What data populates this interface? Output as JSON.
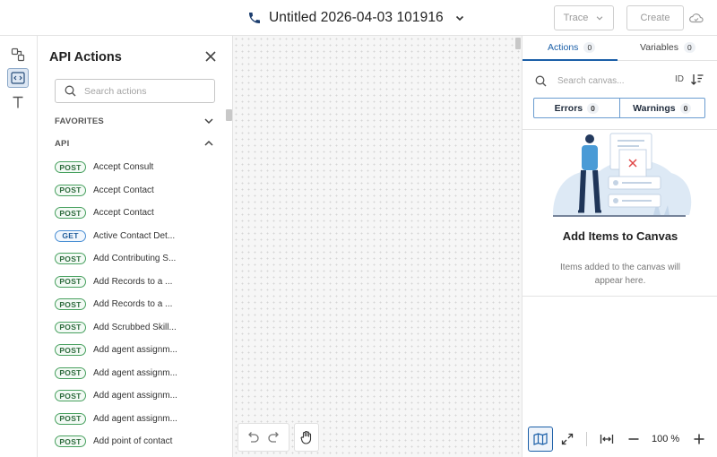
{
  "header": {
    "title": "Untitled 2026-04-03 101916",
    "trace_label": "Trace",
    "create_label": "Create"
  },
  "left_panel": {
    "title": "API Actions",
    "search_placeholder": "Search actions",
    "favorites_label": "FAVORITES",
    "api_label": "API",
    "items": [
      {
        "method": "POST",
        "label": "Accept Consult"
      },
      {
        "method": "POST",
        "label": "Accept Contact"
      },
      {
        "method": "POST",
        "label": "Accept Contact"
      },
      {
        "method": "GET",
        "label": "Active Contact Det..."
      },
      {
        "method": "POST",
        "label": "Add Contributing S..."
      },
      {
        "method": "POST",
        "label": "Add Records to a ..."
      },
      {
        "method": "POST",
        "label": "Add Records to a ..."
      },
      {
        "method": "POST",
        "label": "Add Scrubbed Skill..."
      },
      {
        "method": "POST",
        "label": "Add agent assignm..."
      },
      {
        "method": "POST",
        "label": "Add agent assignm..."
      },
      {
        "method": "POST",
        "label": "Add agent assignm..."
      },
      {
        "method": "POST",
        "label": "Add agent assignm..."
      },
      {
        "method": "POST",
        "label": "Add point of contact"
      }
    ]
  },
  "right_panel": {
    "tabs": [
      {
        "label": "Actions",
        "count": "0"
      },
      {
        "label": "Variables",
        "count": "0"
      }
    ],
    "search_placeholder": "Search canvas...",
    "id_label": "ID",
    "filters": [
      {
        "label": "Errors",
        "count": "0"
      },
      {
        "label": "Warnings",
        "count": "0"
      }
    ],
    "empty_title": "Add Items to Canvas",
    "empty_subtitle": "Items added to the canvas will appear here.",
    "zoom_label": "100 %"
  },
  "colors": {
    "accent": "#1b5fa8",
    "post_badge": "#47a05e",
    "get_badge": "#4a8fd4",
    "canvas_bg": "#f6f6f6"
  }
}
